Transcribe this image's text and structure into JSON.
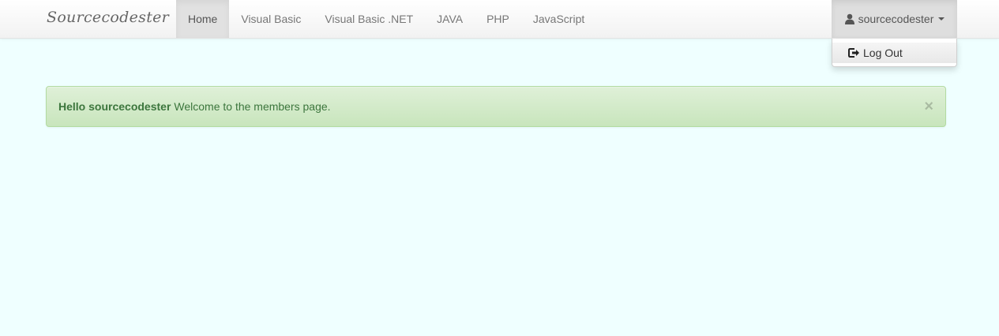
{
  "navbar": {
    "brand": "Sourcecodester",
    "items": [
      {
        "label": "Home",
        "active": true
      },
      {
        "label": "Visual Basic"
      },
      {
        "label": "Visual Basic .NET"
      },
      {
        "label": "JAVA"
      },
      {
        "label": "PHP"
      },
      {
        "label": "JavaScript"
      }
    ],
    "user": {
      "name": "sourcecodester",
      "icon": "user-icon",
      "dropdown": [
        {
          "label": "Log Out",
          "icon": "log-out-icon"
        }
      ]
    }
  },
  "alert": {
    "strong": "Hello sourcecodester",
    "message": "Welcome to the members page.",
    "close": "×"
  },
  "colors": {
    "page_background": "#efffff",
    "alert_text": "#3c763d",
    "alert_background": "#dff0d8"
  }
}
